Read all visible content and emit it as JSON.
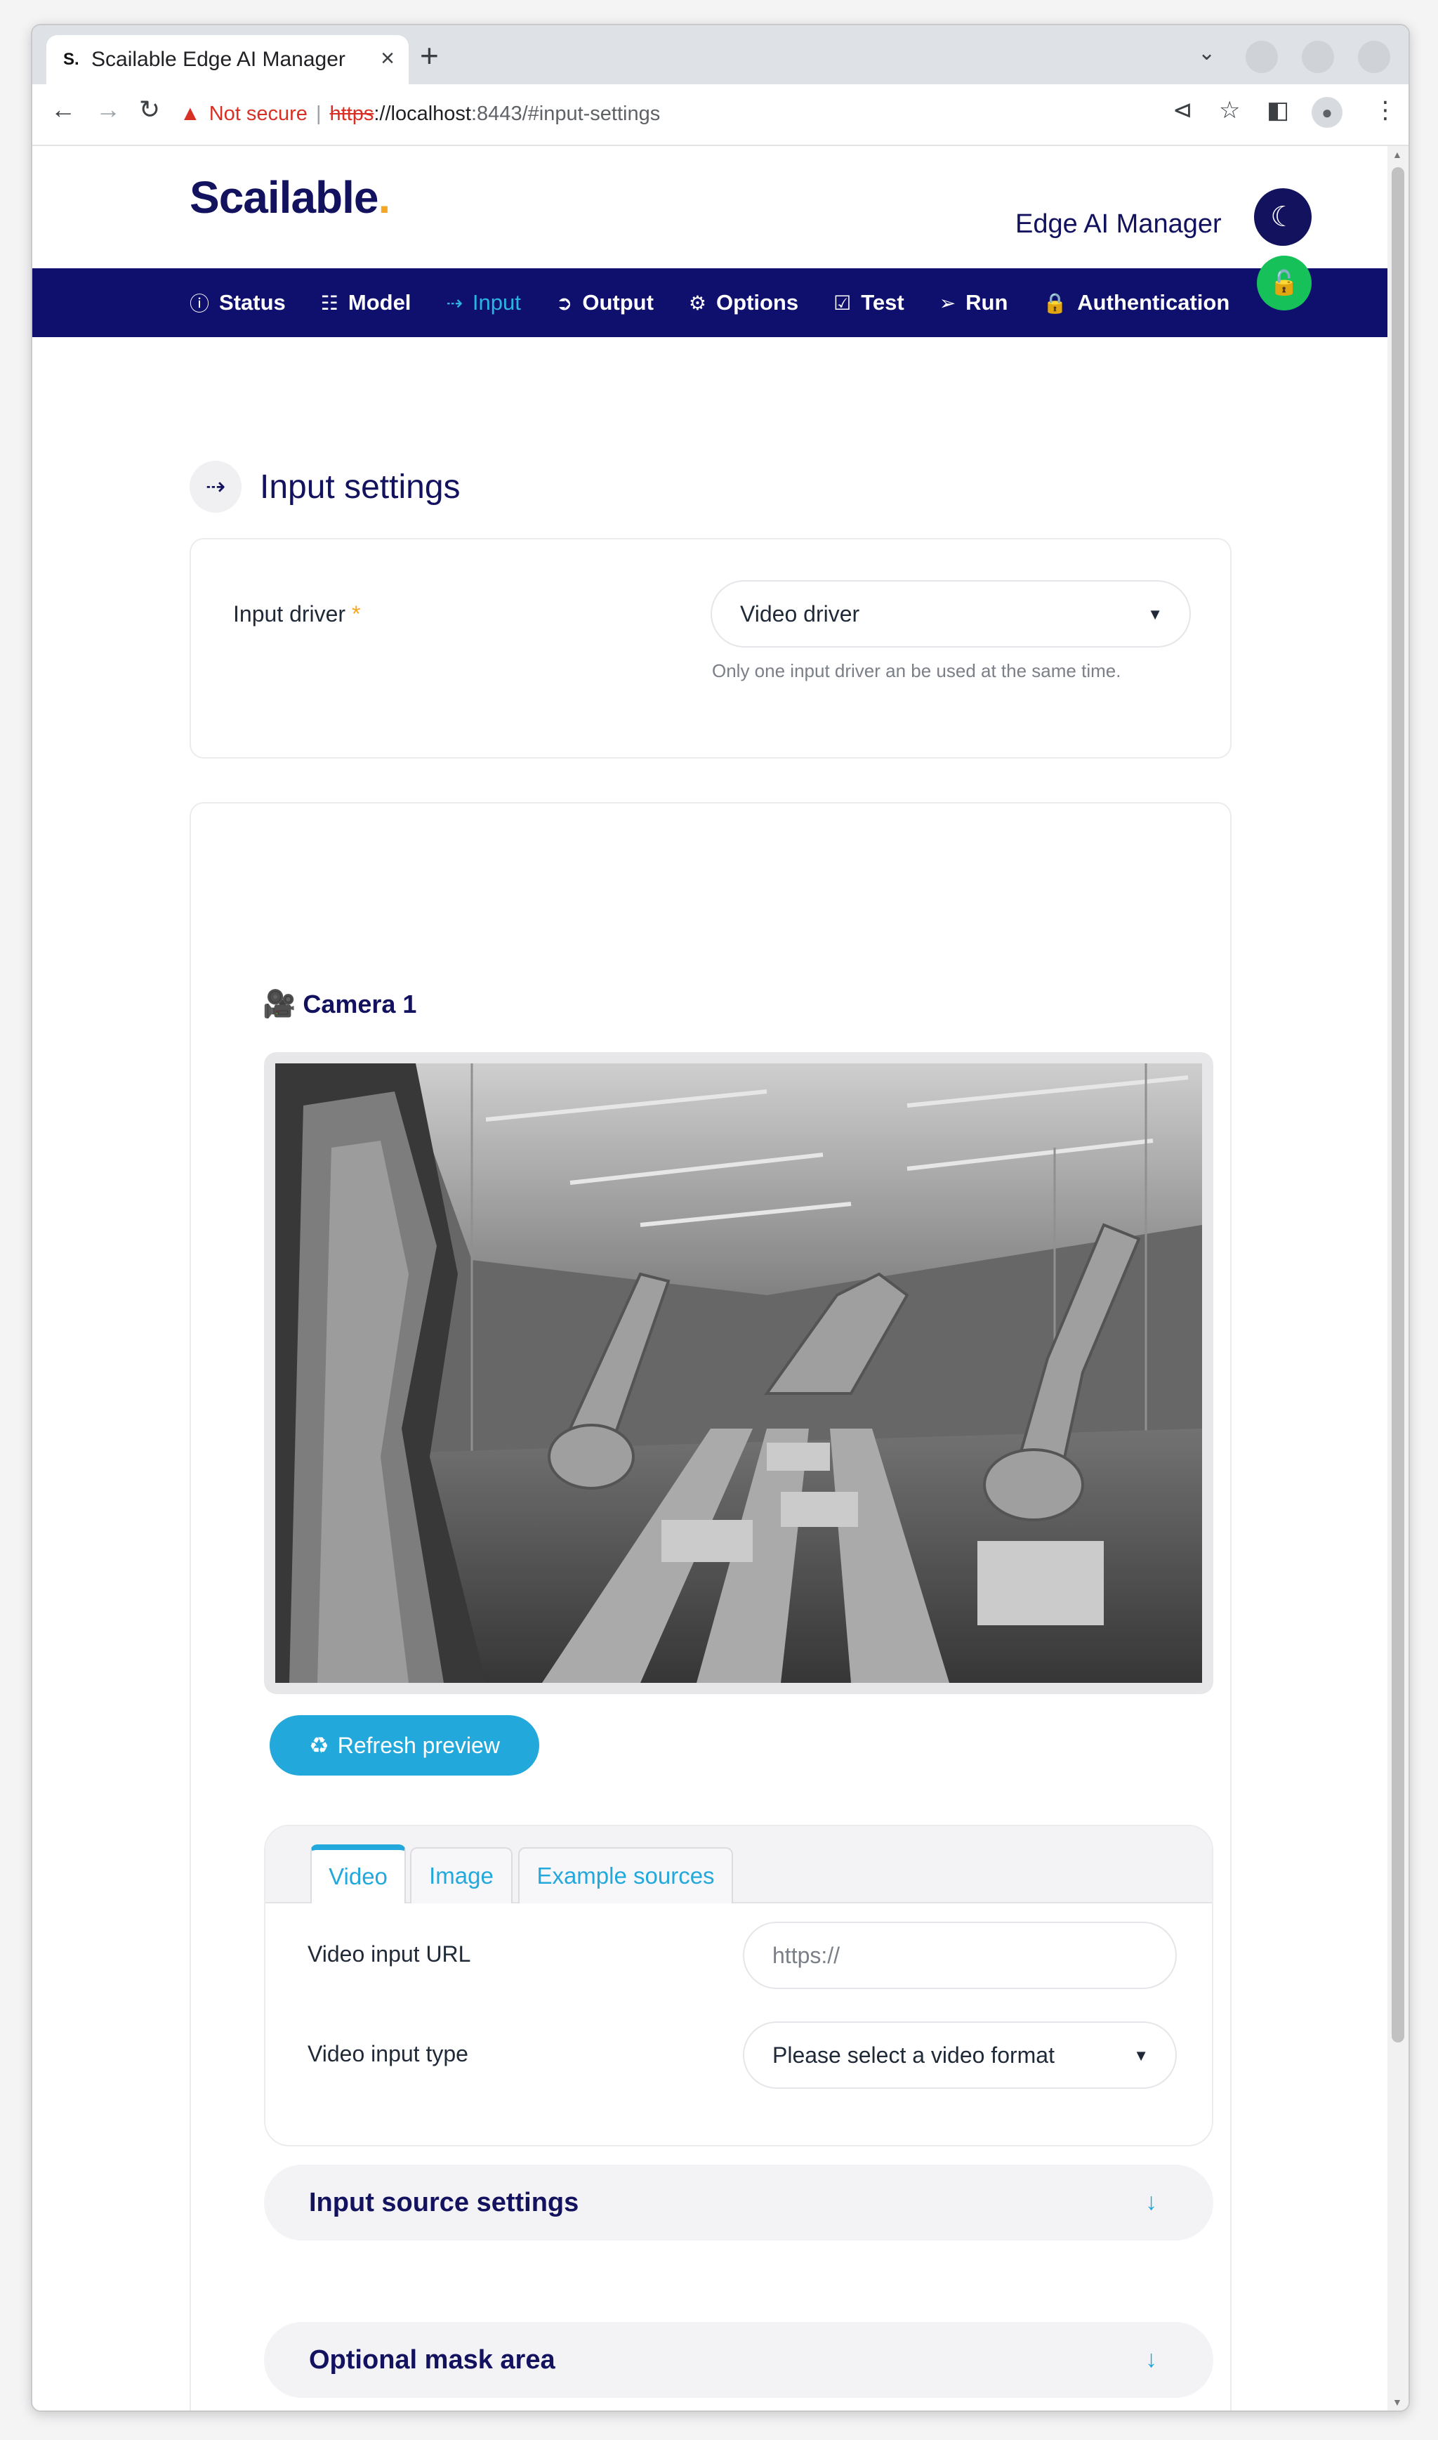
{
  "browser": {
    "tab_favicon": "S.",
    "tab_title": "Scailable Edge AI Manager",
    "tab_close": "×",
    "new_tab": "+",
    "not_secure": "Not secure",
    "url_scheme": "https",
    "url_host": "://localhost",
    "url_rest": ":8443/#input-settings"
  },
  "header": {
    "logo": "Scailable",
    "logo_dot": ".",
    "app_title": "Edge AI Manager"
  },
  "nav": {
    "items": [
      {
        "label": "Status",
        "icon": "info-icon"
      },
      {
        "label": "Model",
        "icon": "sitemap-icon"
      },
      {
        "label": "Input",
        "icon": "login-icon",
        "active": true
      },
      {
        "label": "Output",
        "icon": "logout-icon"
      },
      {
        "label": "Options",
        "icon": "gear-icon"
      },
      {
        "label": "Test",
        "icon": "checkbox-icon"
      },
      {
        "label": "Run",
        "icon": "arrow-circle-icon"
      },
      {
        "label": "Authentication",
        "icon": "lock-icon"
      }
    ]
  },
  "page": {
    "title": "Input settings",
    "input_driver_label": "Input driver",
    "required_mark": "*",
    "input_driver_value": "Video driver",
    "input_driver_hint": "Only one input driver an be used at the same time.",
    "camera_title": "Camera 1",
    "refresh_label": "Refresh preview",
    "tabs": [
      "Video",
      "Image",
      "Example sources"
    ],
    "active_tab": "Video",
    "video_url_label": "Video input URL",
    "video_url_placeholder": "https://",
    "video_type_label": "Video input type",
    "video_type_value": "Please select a video format",
    "accordion_input_source": "Input source settings",
    "accordion_mask": "Optional mask area"
  },
  "colors": {
    "brand_navy": "#0f0f6e",
    "accent_blue": "#23a8dc",
    "accent_orange": "#f5a623",
    "success_green": "#16c15a"
  }
}
